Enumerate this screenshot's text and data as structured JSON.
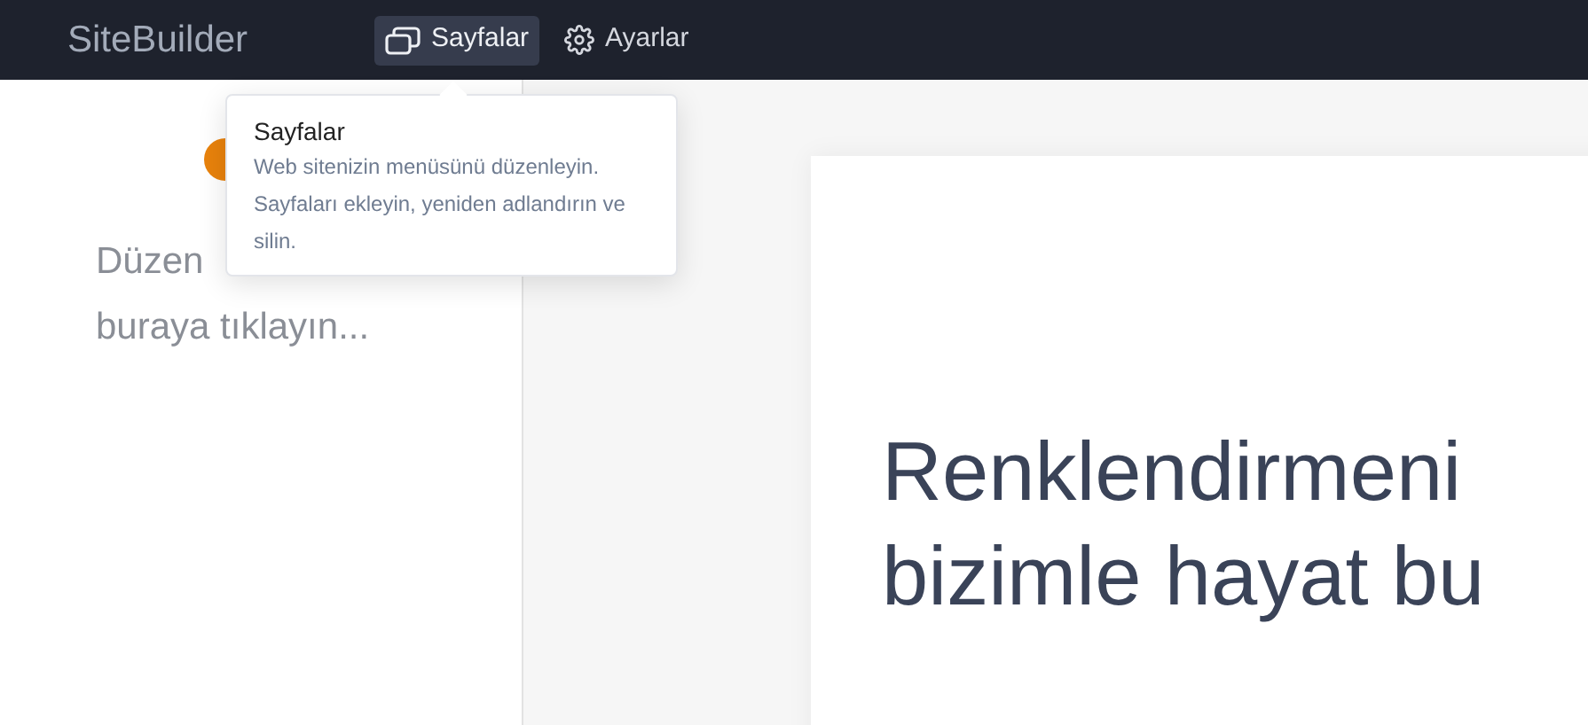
{
  "topbar": {
    "brand": "SiteBuilder",
    "nav": [
      {
        "label": "Sayfalar",
        "selected": true
      },
      {
        "label": "Ayarlar",
        "selected": false
      }
    ]
  },
  "tooltip": {
    "title": "Sayfalar",
    "text": "Web sitenizin menüsünü düzenleyin. Sayfaları ekleyin, yeniden adlandırın ve silin."
  },
  "sidebar": {
    "lines": [
      "Düzen",
      "buraya tıklayın..."
    ]
  },
  "canvas": {
    "headline_lines": [
      "Renklendirmeni",
      "bizimle hayat bu"
    ]
  }
}
